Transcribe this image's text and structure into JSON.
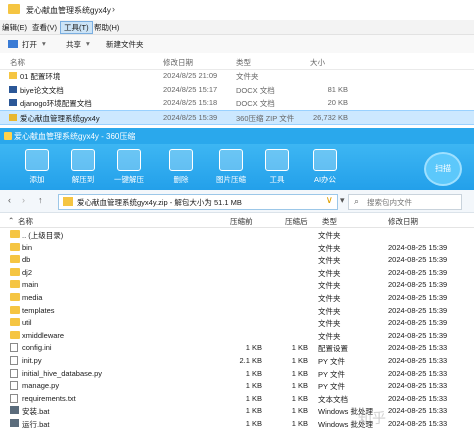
{
  "explorer": {
    "title": "爱心献血管理系统gyx4y",
    "menu": [
      "编辑(E)",
      "查看(V)",
      "工具(T)",
      "帮助(H)"
    ],
    "menu_active": "工具(T)",
    "toolbar": [
      "打开",
      "共享",
      "新建文件夹"
    ],
    "columns": [
      "名称",
      "修改日期",
      "类型",
      "大小"
    ],
    "rows": [
      {
        "name": "01 配置环境",
        "date": "2024/8/25 21:09",
        "type": "文件夹",
        "size": "",
        "icon": "folder-icon"
      },
      {
        "name": "biye论文文档",
        "date": "2024/8/25 15:17",
        "type": "DOCX 文档",
        "size": "81 KB",
        "icon": "docx-icon"
      },
      {
        "name": "djanogo环境配置文档",
        "date": "2024/8/25 15:18",
        "type": "DOCX 文档",
        "size": "20 KB",
        "icon": "docx-icon"
      },
      {
        "name": "爱心献血管理系统gyx4y",
        "date": "2024/8/25 15:39",
        "type": "360压缩 ZIP 文件",
        "size": "26,732 KB",
        "icon": "zip-icon",
        "selected": true
      }
    ]
  },
  "zip": {
    "title": "爱心献血管理系统gyx4y - 360压缩",
    "tools": [
      {
        "label": "添加",
        "icon": "add-icon",
        "color": "#ffffff"
      },
      {
        "label": "解压到",
        "icon": "extract-icon",
        "color": "#ffffff"
      },
      {
        "label": "一键解压",
        "icon": "one-click-extract-icon",
        "color": "#ffffff"
      },
      {
        "label": "删除",
        "icon": "delete-icon",
        "color": "#ffffff"
      },
      {
        "label": "图片压缩",
        "icon": "image-compress-icon",
        "color": "#ffffff"
      },
      {
        "label": "工具",
        "icon": "tools-icon",
        "color": "#ffffff"
      },
      {
        "label": "AI办公",
        "icon": "ai-office-icon",
        "color": "#ffffff"
      }
    ],
    "scan_label": "扫描",
    "path_text": "爱心献血管理系统gyx4y.zip - 解包大小为 51.1 MB",
    "search_placeholder": "搜索包内文件",
    "columns": [
      "名称",
      "压缩前",
      "压缩后",
      "类型",
      "修改日期"
    ],
    "rows": [
      {
        "name": ".. (上级目录)",
        "before": "",
        "after": "",
        "type": "文件夹",
        "date": "",
        "kind": "folder"
      },
      {
        "name": "bin",
        "before": "",
        "after": "",
        "type": "文件夹",
        "date": "2024-08-25 15:39",
        "kind": "folder"
      },
      {
        "name": "db",
        "before": "",
        "after": "",
        "type": "文件夹",
        "date": "2024-08-25 15:39",
        "kind": "folder"
      },
      {
        "name": "dj2",
        "before": "",
        "after": "",
        "type": "文件夹",
        "date": "2024-08-25 15:39",
        "kind": "folder"
      },
      {
        "name": "main",
        "before": "",
        "after": "",
        "type": "文件夹",
        "date": "2024-08-25 15:39",
        "kind": "folder"
      },
      {
        "name": "media",
        "before": "",
        "after": "",
        "type": "文件夹",
        "date": "2024-08-25 15:39",
        "kind": "folder"
      },
      {
        "name": "templates",
        "before": "",
        "after": "",
        "type": "文件夹",
        "date": "2024-08-25 15:39",
        "kind": "folder"
      },
      {
        "name": "util",
        "before": "",
        "after": "",
        "type": "文件夹",
        "date": "2024-08-25 15:39",
        "kind": "folder"
      },
      {
        "name": "xmiddleware",
        "before": "",
        "after": "",
        "type": "文件夹",
        "date": "2024-08-25 15:39",
        "kind": "folder"
      },
      {
        "name": "config.ini",
        "before": "1 KB",
        "after": "1 KB",
        "type": "配置设置",
        "date": "2024-08-25 15:33",
        "kind": "file"
      },
      {
        "name": "init.py",
        "before": "2.1 KB",
        "after": "1 KB",
        "type": "PY 文件",
        "date": "2024-08-25 15:33",
        "kind": "file"
      },
      {
        "name": "initial_hive_database.py",
        "before": "1 KB",
        "after": "1 KB",
        "type": "PY 文件",
        "date": "2024-08-25 15:33",
        "kind": "file"
      },
      {
        "name": "manage.py",
        "before": "1 KB",
        "after": "1 KB",
        "type": "PY 文件",
        "date": "2024-08-25 15:33",
        "kind": "file"
      },
      {
        "name": "requirements.txt",
        "before": "1 KB",
        "after": "1 KB",
        "type": "文本文档",
        "date": "2024-08-25 15:33",
        "kind": "file"
      },
      {
        "name": "安装.bat",
        "before": "1 KB",
        "after": "1 KB",
        "type": "Windows 批处理",
        "date": "2024-08-25 15:33",
        "kind": "bat"
      },
      {
        "name": "运行.bat",
        "before": "1 KB",
        "after": "1 KB",
        "type": "Windows 批处理",
        "date": "2024-08-25 15:33",
        "kind": "bat"
      }
    ]
  },
  "watermark": "知乎"
}
